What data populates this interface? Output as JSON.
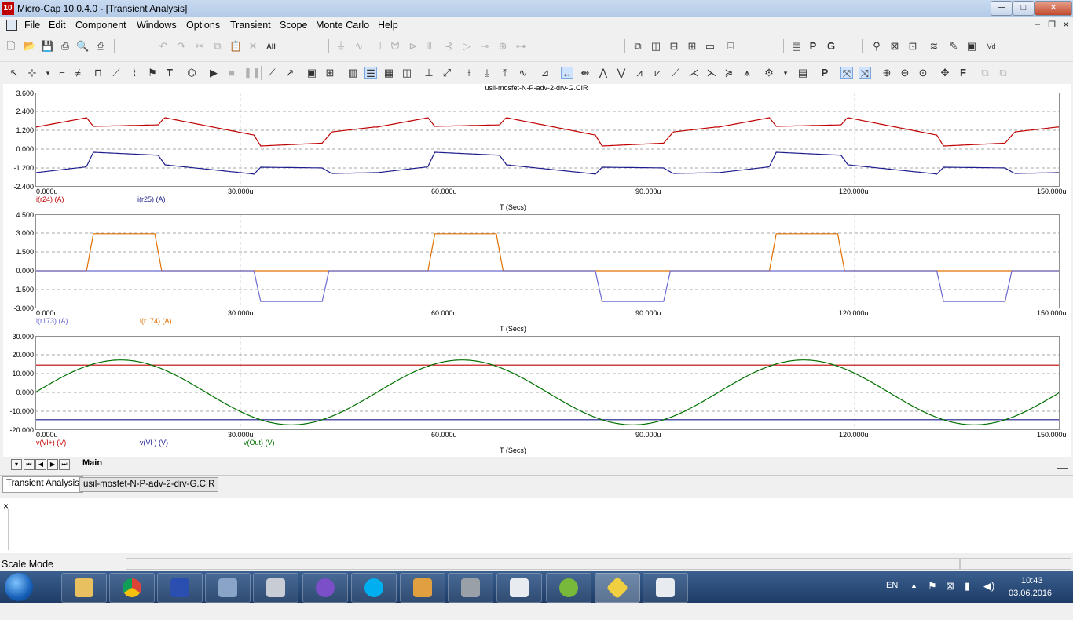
{
  "window": {
    "app_icon_text": "10",
    "title": "Micro-Cap 10.0.4.0 - [Transient Analysis]",
    "controls": {
      "minimize": "─",
      "maximize": "□",
      "close": "✕"
    }
  },
  "menu": {
    "items": [
      "File",
      "Edit",
      "Component",
      "Windows",
      "Options",
      "Transient",
      "Scope",
      "Monte Carlo",
      "Help"
    ],
    "mdi": {
      "minimize": "–",
      "restore": "❐",
      "close": "✕"
    }
  },
  "plot": {
    "file_title": "usil-mosfet-N-P-adv-2-drv-G.CIR",
    "x_title": "T (Secs)",
    "x_ticks": [
      "0.000u",
      "30.000u",
      "60.000u",
      "90.000u",
      "120.000u",
      "150.000u"
    ],
    "panels": [
      {
        "y_ticks": [
          "3.600",
          "2.400",
          "1.200",
          "0.000",
          "-1.200",
          "-2.400"
        ],
        "legend": [
          {
            "label": "i(r24) (A)",
            "color": "#c00000"
          },
          {
            "label": "i(r25) (A)",
            "color": "#1c1c8c"
          }
        ]
      },
      {
        "y_ticks": [
          "4.500",
          "3.000",
          "1.500",
          "0.000",
          "-1.500",
          "-3.000"
        ],
        "legend": [
          {
            "label": "i(r173) (A)",
            "color": "#6a6ad0"
          },
          {
            "label": "i(r174) (A)",
            "color": "#e07000"
          }
        ]
      },
      {
        "y_ticks": [
          "30.000",
          "20.000",
          "10.000",
          "0.000",
          "-10.000",
          "-20.000"
        ],
        "legend": [
          {
            "label": "v(Vl+) (V)",
            "color": "#c00000"
          },
          {
            "label": "v(Vl-) (V)",
            "color": "#1c1c8c"
          },
          {
            "label": "v(Out) (V)",
            "color": "#007000"
          }
        ]
      }
    ],
    "page_tab": "Main"
  },
  "doc_tabs": [
    "Transient Analysis",
    "usil-mosfet-N-P-adv-2-drv-G.CIR"
  ],
  "output_close": "×",
  "status": {
    "mode": "Scale Mode"
  },
  "taskbar": {
    "lang": "EN",
    "time": "10:43",
    "date": "03.06.2016"
  }
}
